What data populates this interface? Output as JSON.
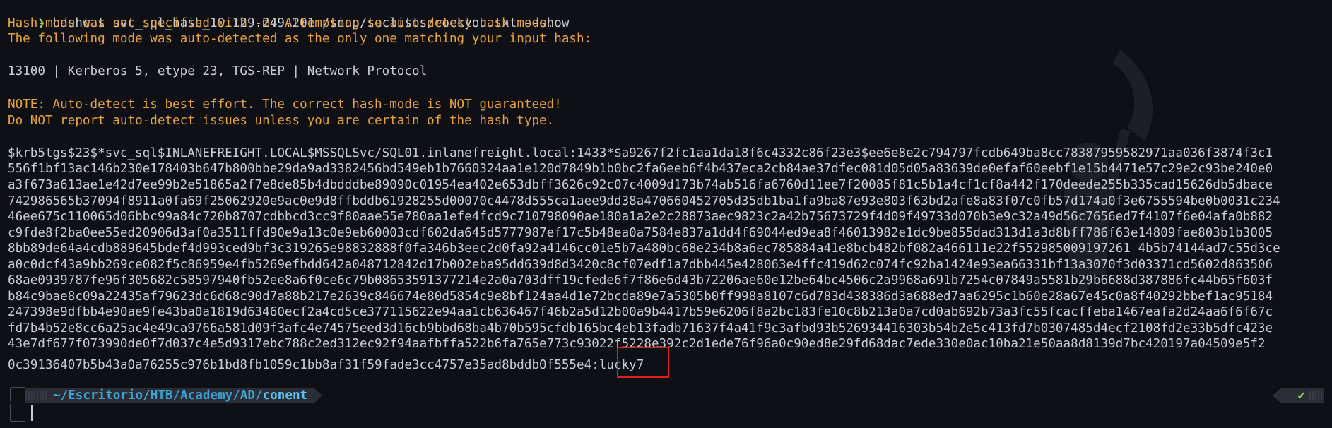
{
  "command": {
    "prompt_symbol": "❯",
    "program": "hashcat",
    "hash_file": "svc_sql_hash_10.129.249.201",
    "wordlist": "/snap/seclists/rockyou.txt",
    "flag": "--show"
  },
  "output": {
    "line1": "Hash-mode was not specified with -m. Attempting to auto-detect hash mode.",
    "line2": "The following mode was auto-detected as the only one matching your input hash:",
    "mode_line": "13100 | Kerberos 5, etype 23, TGS-REP | Network Protocol",
    "note1": "NOTE: Auto-detect is best effort. The correct hash-mode is NOT guaranteed!",
    "note2": "Do NOT report auto-detect issues unless you are certain of the hash type.",
    "hash_lines": [
      "$krb5tgs$23$*svc_sql$INLANEFREIGHT.LOCAL$MSSQLSvc/SQL01.inlanefreight.local:1433*$a9267f2fc1aa1da18f6c4332c86f23e3$ee6e8e2c794797fcdb649ba8cc78387959582971aa036f3874f3c1",
      "556f1bf13ac146b230e178403b647b800bbe29da9ad3382456bd549eb1b7660324aa1e120d7849b1b0bc2fa6eeb6f4b437eca2cb84ae37dfec081d05d05a83639de0efaf60eebf1e15b4471e57c29e2c93be240e0",
      "a3f673a613ae1e42d7ee99b2e51865a2f7e8de85b4dbdddbe89090c01954ea402e653dbff3626c92c07c4009d173b74ab516fa6760d11ee7f20085f81c5b1a4cf1cf8a442f170deede255b335cad15626db5dbace",
      "742986565b37094f8911a0fa69f25062920e9ac0e9d8ffbddb61928255d00070c4478d555ca1aee9dd38a470660452705d35db1ba1fa9ba87e93e803f63bd2afe8a83f07c0fb57d174a0f3e6755594be0b0031c234",
      "46ee675c110065d06bbc99a84c720b8707cdbbcd3cc9f80aae55e780aa1efe4fcd9c710798090ae180a1a2e2c28873aec9823c2a42b75673729f4d09f49733d070b3e9c32a49d56c7656ed7f4107f6e04afa0b882",
      "c9fde8f2ba0ee55ed20906d3af0a3511ffd90e9a13c0e9eb60003cdf602da645d5777987ef17c5b48ea0a7584e837a1dd4f69044ed9ea8f46013982e1dc9be855dad313d1a3d8bff786f63e14809fae803b1b3005",
      "8bb89de64a4cdb889645bdef4d993ced9bf3c319265e98832888f0fa346b3eec2d0fa92a4146cc01e5b7a480bc68e234b8a6ec785884a41e8bcb482bf082a466111e22f552985009197261 4b5b74144ad7c55d3ce",
      "a0c0dcf43a9bb269ce082f5c86959e4fb5269efbdd642a048712842d17b002eba95dd639d8d3420c8cf07edf1a7dbb445e428063e4ffc419d62c074fc92ba1424e93ea66331bf13a3070f3d03371cd5602d863506",
      "68ae0939787fe96f305682c58597940fb52ee8a6f0ce6c79b08653591377214e2a0a703dff19cfede6f7f86e6d43b72206ae60e12be64bc4506c2a9968a691b7254c07849a5581b29b6688d387886fc44b65f603f",
      "b84c9bae8c09a22435af79623dc6d68c90d7a88b217e2639c846674e80d5854c9e8bf124aa4d1e72bcda89e7a5305b0ff998a8107c6d783d438386d3a688ed7aa6295c1b60e28a67e45c0a8f40292bbef1ac95184",
      "247398e9dfbb4e90ae9fe43ba0a1819d63460ecf2a4cd5ce377115622e94aa1cb636467f46b2a5d12b00a9b4417b59e6206f8a2bc183fe10c8b213a0a7cd0ab692b73a3fc55fcacffeba1467eafa2d24aa6f6f67c",
      "fd7b4b52e8cc6a25ac4e49ca9766a581d09f3afc4e74575eed3d16cb9bbd68ba4b70b595cfdb165bc4eb13fadb71637f4a41f9c3afbd93b526934416303b54b2e5c413fd7b0307485d4ecf2108fd2e33b5dfc423e",
      "43e7df677f073990de0f7d037c4e5d9317ebc788c2ed312ec92f94aafbffa522b6fa765e773c93022f5228e392c2d1ede76f96a0c90ed8e29fd68dac7ede330e0ac10ba21e50aa8d8139d7bc420197a04509e5f2",
      "0c39136407b5b43a0a76255c976b1bd8fb1059c1bb8af31f59fade3cc4757e35ad8bddb0f555e4:"
    ],
    "cracked_password": "lucky7"
  },
  "statusbar": {
    "path_prefix": "~/Escritorio/HTB/Academy/AD/",
    "path_last": "conent",
    "status_icon": "✔"
  }
}
